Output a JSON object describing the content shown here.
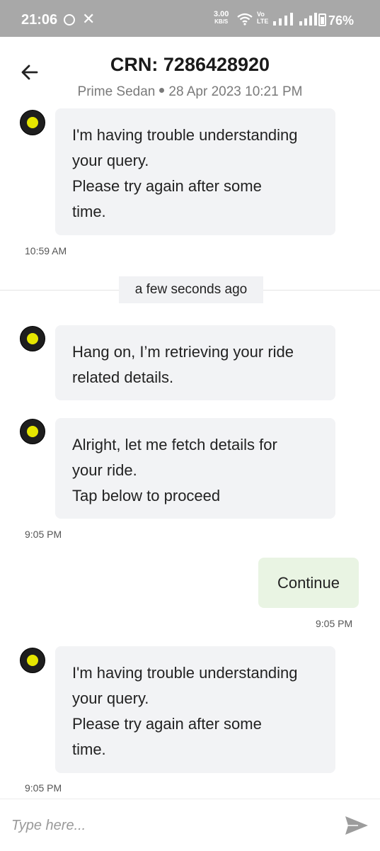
{
  "status_bar": {
    "time": "21:06",
    "speed_value": "3.00",
    "speed_unit": "KB/S",
    "volte_top": "Vo",
    "volte_bottom": "LTE",
    "battery": "76%"
  },
  "header": {
    "title": "CRN: 7286428920",
    "car_type": "Prime Sedan",
    "date_time": "28 Apr 2023 10:21 PM"
  },
  "messages": {
    "bot1": {
      "lines": [
        "I'm having trouble understanding",
        "your query.",
        "Please try again after some",
        "time."
      ],
      "time": "10:59 AM"
    },
    "separator_label": "a few seconds ago",
    "bot2": {
      "lines": [
        "Hang on, I’m retrieving your ride",
        "related details."
      ]
    },
    "bot3": {
      "lines": [
        "Alright, let me fetch details for",
        "your ride.",
        "Tap below to proceed"
      ],
      "time": "9:05 PM"
    },
    "user1": {
      "text": "Continue",
      "time": "9:05 PM"
    },
    "bot4": {
      "lines": [
        "I'm having trouble understanding",
        "your query.",
        "Please try again after some",
        "time."
      ],
      "time": "9:05 PM"
    }
  },
  "input": {
    "placeholder": "Type here...",
    "value": ""
  },
  "icons": {
    "back": "arrow-left-icon",
    "send": "send-icon",
    "avatar": "ola-bot-avatar"
  },
  "colors": {
    "status_bar_bg": "#a8a8a8",
    "bot_bubble_bg": "#f2f3f5",
    "user_bubble_bg": "#e9f4e3",
    "avatar_accent": "#e6e600"
  }
}
